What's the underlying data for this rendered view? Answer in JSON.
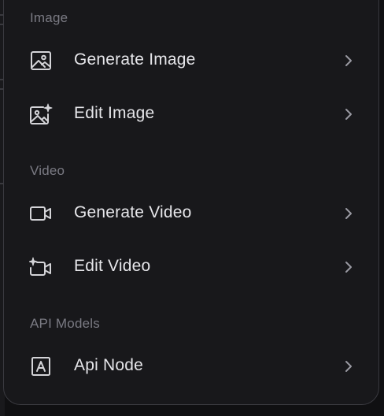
{
  "menu": {
    "sections": [
      {
        "label": "Image",
        "items": [
          {
            "label": "Generate Image",
            "icon": "image-icon"
          },
          {
            "label": "Edit Image",
            "icon": "image-sparkle-icon"
          }
        ]
      },
      {
        "label": "Video",
        "items": [
          {
            "label": "Generate Video",
            "icon": "video-camera-icon"
          },
          {
            "label": "Edit Video",
            "icon": "video-sparkle-icon"
          }
        ]
      },
      {
        "label": "API Models",
        "items": [
          {
            "label": "Api Node",
            "icon": "api-box-icon"
          }
        ]
      }
    ]
  },
  "colors": {
    "menu_background": "#18181b",
    "text": "#e6e6ea",
    "section_label": "#7a7a83",
    "icon": "#d4d4d8",
    "chevron": "#9a9aa3"
  }
}
